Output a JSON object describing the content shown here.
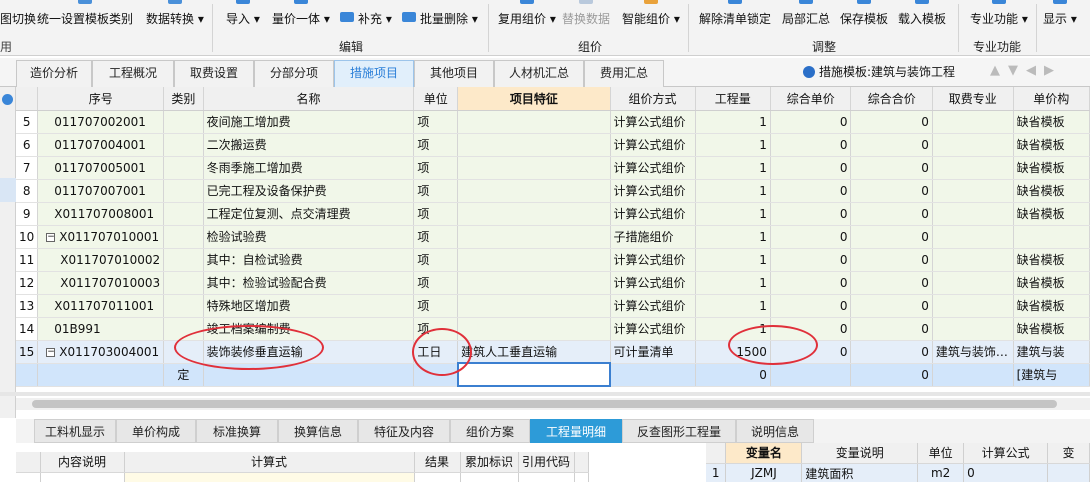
{
  "ribbon": {
    "buttons": [
      "图切换",
      "统一设置模板类别",
      "数据转换",
      "导入",
      "量价一体",
      "补充",
      "批量删除",
      "复用组价",
      "替换数据",
      "智能组价",
      "解除清单锁定",
      "局部汇总",
      "保存模板",
      "载入模板",
      "专业功能",
      "显示"
    ],
    "groups": [
      "编辑",
      "组价",
      "调整",
      "专业功能"
    ]
  },
  "tabs": [
    "造价分析",
    "工程概况",
    "取费设置",
    "分部分项",
    "措施项目",
    "其他项目",
    "人材机汇总",
    "费用汇总"
  ],
  "template_label": "措施模板:建筑与装饰工程",
  "table": {
    "headers": [
      "序号",
      "类别",
      "名称",
      "单位",
      "项目特征",
      "组价方式",
      "工程量",
      "综合单价",
      "综合合价",
      "取费专业",
      "单价构"
    ],
    "rows": [
      {
        "n": "5",
        "code": "011707002001",
        "cat": "",
        "name": "夜间施工增加费",
        "unit": "项",
        "feat": "",
        "method": "计算公式组价",
        "qty": "1",
        "price": "0",
        "total": "0",
        "major": "",
        "pc": "缺省模板"
      },
      {
        "n": "6",
        "code": "011707004001",
        "cat": "",
        "name": "二次搬运费",
        "unit": "项",
        "feat": "",
        "method": "计算公式组价",
        "qty": "1",
        "price": "0",
        "total": "0",
        "major": "",
        "pc": "缺省模板"
      },
      {
        "n": "7",
        "code": "011707005001",
        "cat": "",
        "name": "冬雨季施工增加费",
        "unit": "项",
        "feat": "",
        "method": "计算公式组价",
        "qty": "1",
        "price": "0",
        "total": "0",
        "major": "",
        "pc": "缺省模板"
      },
      {
        "n": "8",
        "code": "011707007001",
        "cat": "",
        "name": "已完工程及设备保护费",
        "unit": "项",
        "feat": "",
        "method": "计算公式组价",
        "qty": "1",
        "price": "0",
        "total": "0",
        "major": "",
        "pc": "缺省模板"
      },
      {
        "n": "9",
        "code": "X011707008001",
        "cat": "",
        "name": "工程定位复测、点交清理费",
        "unit": "项",
        "feat": "",
        "method": "计算公式组价",
        "qty": "1",
        "price": "0",
        "total": "0",
        "major": "",
        "pc": "缺省模板"
      },
      {
        "n": "10",
        "code": "X011707010001",
        "cat": "",
        "name": "检验试验费",
        "unit": "项",
        "feat": "",
        "method": "子措施组价",
        "qty": "1",
        "price": "0",
        "total": "0",
        "major": "",
        "pc": ""
      },
      {
        "n": "11",
        "code": "X011707010002",
        "cat": "",
        "name": "其中：自检试验费",
        "unit": "项",
        "feat": "",
        "method": "计算公式组价",
        "qty": "1",
        "price": "0",
        "total": "0",
        "major": "",
        "pc": "缺省模板"
      },
      {
        "n": "12",
        "code": "X011707010003",
        "cat": "",
        "name": "其中：检验试验配合费",
        "unit": "项",
        "feat": "",
        "method": "计算公式组价",
        "qty": "1",
        "price": "0",
        "total": "0",
        "major": "",
        "pc": "缺省模板"
      },
      {
        "n": "13",
        "code": "X011707011001",
        "cat": "",
        "name": "特殊地区增加费",
        "unit": "项",
        "feat": "",
        "method": "计算公式组价",
        "qty": "1",
        "price": "0",
        "total": "0",
        "major": "",
        "pc": "缺省模板"
      },
      {
        "n": "14",
        "code": "01B991",
        "cat": "",
        "name": "竣工档案编制费",
        "unit": "项",
        "feat": "",
        "method": "计算公式组价",
        "qty": "1",
        "price": "0",
        "total": "0",
        "major": "",
        "pc": "缺省模板"
      },
      {
        "n": "15",
        "code": "X011703004001",
        "cat": "",
        "name": "装饰装修垂直运输",
        "unit": "工日",
        "feat": "建筑人工垂直运输",
        "method": "可计量清单",
        "qty": "1500",
        "price": "0",
        "total": "0",
        "major": "建筑与装饰…",
        "pc": "建筑与装"
      },
      {
        "n": "",
        "code": "",
        "cat": "定",
        "name": "",
        "unit": "",
        "feat": "",
        "method": "",
        "qty": "0",
        "price": "",
        "total": "0",
        "major": "",
        "pc": "[建筑与"
      }
    ]
  },
  "bottom_tabs": [
    "工料机显示",
    "单价构成",
    "标准换算",
    "换算信息",
    "特征及内容",
    "组价方案",
    "工程量明细",
    "反查图形工程量",
    "说明信息"
  ],
  "detail_headers": [
    "内容说明",
    "计算式",
    "结果",
    "累加标识",
    "引用代码"
  ],
  "var_headers": [
    "变量名",
    "变量说明",
    "单位",
    "计算公式",
    "变"
  ],
  "var_rows": [
    {
      "n": "1",
      "name": "JZMJ",
      "desc": "建筑面积",
      "unit": "m2",
      "formula": "0"
    }
  ]
}
